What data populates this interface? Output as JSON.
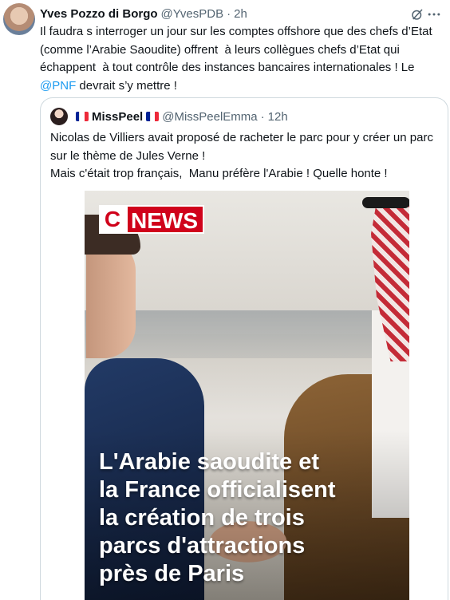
{
  "tweet": {
    "author_name": "Yves Pozzo di Borgo",
    "author_handle": "@YvesPDB",
    "separator": "·",
    "time": "2h",
    "text_before_mention": "Il faudra s interroger un jour sur les comptes offshore que des chefs d’Etat\n(comme l’Arabie Saoudite) offrent  à leurs collègues chefs d’Etat qui\néchappent  à tout contrôle des instances bancaires internationales ! Le\n",
    "mention": "@PNF",
    "text_after_mention": " devrait s’y mettre !",
    "icons": [
      "avatar",
      "grok-icon",
      "more-icon"
    ]
  },
  "quote": {
    "author_name": "MissPeel",
    "author_handle": "@MissPeelEmma",
    "separator": "·",
    "time": "12h",
    "text": "Nicolas de Villiers avait proposé de racheter le parc pour y créer un parc\nsur le thème de Jules Verne !\nMais c'était trop français,  Manu préfère l'Arabie ! Quelle honte !",
    "flag_colors": [
      "#002395",
      "#ffffff",
      "#ed2939"
    ],
    "image": {
      "logo_c": "C",
      "logo_news": "NEWS",
      "headline_lines": [
        "L'Arabie saoudite et",
        "la France officialisent",
        "la création de trois",
        "parcs d'attractions",
        "près de Paris"
      ]
    }
  },
  "colors": {
    "text": "#0f1419",
    "secondary": "#536471",
    "link": "#1d9bf0",
    "border": "#cfd9de",
    "cnews_red": "#d0021b"
  }
}
